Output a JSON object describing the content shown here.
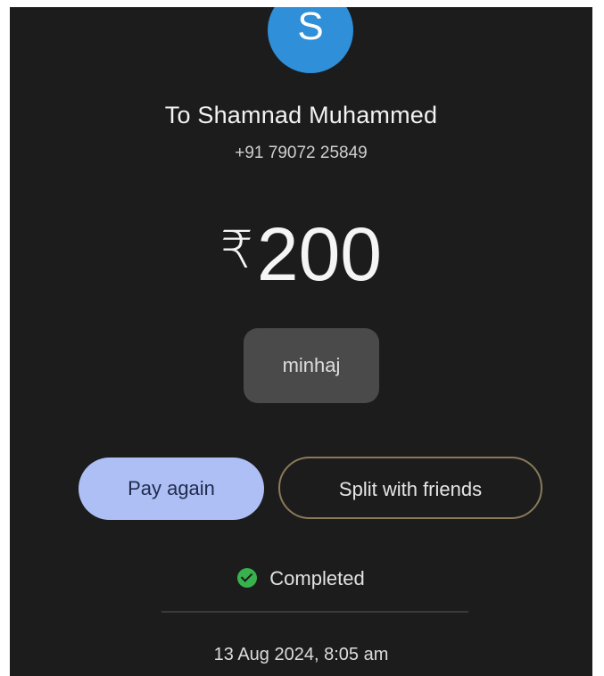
{
  "avatar": {
    "initial": "S",
    "color": "#2f8fd8"
  },
  "recipient": {
    "name": "To Shamnad Muhammed",
    "phone": "+91 79072 25849"
  },
  "payment": {
    "currency_symbol": "₹",
    "amount": "200",
    "note": "minhaj"
  },
  "actions": {
    "pay_again_label": "Pay again",
    "split_label": "Split with friends"
  },
  "status": {
    "icon": "check-circle-icon",
    "label": "Completed",
    "color": "#37b24d"
  },
  "timestamp": "13 Aug 2024, 8:05 am"
}
